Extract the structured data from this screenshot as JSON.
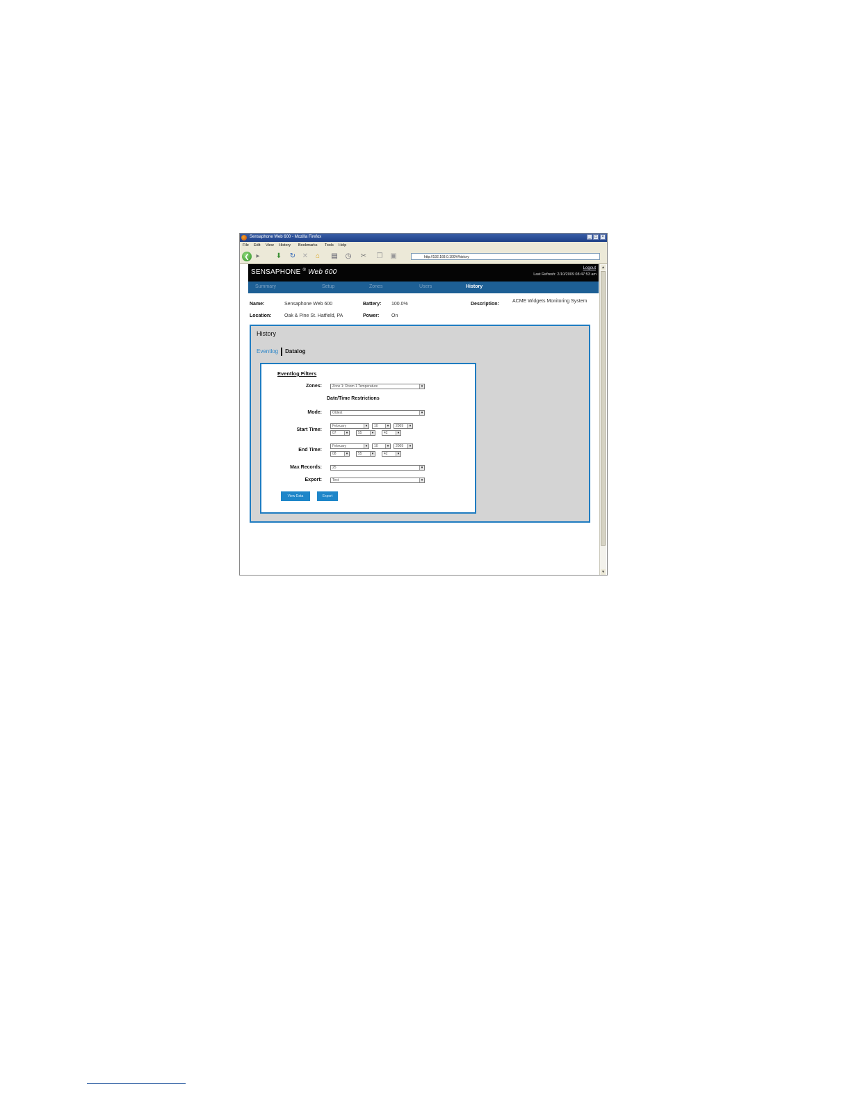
{
  "window": {
    "title": "Sensaphone Web 600 - Mozilla Firefox",
    "controls": [
      "_",
      "□",
      "×"
    ],
    "menu": [
      "File",
      "Edit",
      "View",
      "History",
      "Bookmarks",
      "Tools",
      "Help"
    ],
    "url": "http://192.168.0.100/#/history"
  },
  "header": {
    "brand": "SENSAPHONE",
    "registered": "®",
    "model": "Web 600",
    "logout": "Logout",
    "last_refresh": "Last Refresh: 2/10/2009 08:47:53 am"
  },
  "tabs": [
    "Summary",
    "Setup",
    "Zones",
    "Users",
    "History"
  ],
  "active_tab": "History",
  "device_info": {
    "name_label": "Name:",
    "name": "Sensaphone Web 600",
    "location_label": "Location:",
    "location": "Oak & Pine St. Hatfield, PA",
    "battery_label": "Battery:",
    "battery": "100.0%",
    "power_label": "Power:",
    "power": "On",
    "description_label": "Description:",
    "description": "ACME Widgets Monitoring System"
  },
  "history": {
    "title": "History",
    "subnav": [
      "Eventlog",
      "Datalog"
    ],
    "active_subnav": "Eventlog",
    "filters": {
      "heading": "Eventlog Filters",
      "zones_label": "Zones:",
      "zones_value": "Zone 1: Room 1 Temperature",
      "restrictions_heading": "Date/Time Restrictions",
      "mode_label": "Mode:",
      "mode_value": "Oldest",
      "start_label": "Start Time:",
      "start": {
        "month": "February",
        "day": "10",
        "year": "2009",
        "hour": "07",
        "minute": "55",
        "second": "42"
      },
      "end_label": "End Time:",
      "end": {
        "month": "February",
        "day": "10",
        "year": "2009",
        "hour": "08",
        "minute": "55",
        "second": "42"
      },
      "max_records_label": "Max Records:",
      "max_records_value": "25",
      "export_label": "Export:",
      "export_value": "Text",
      "view_button": "View Data",
      "export_button": "Export"
    }
  },
  "colors": {
    "nav_blue": "#1d5f95",
    "frame_blue": "#1f7cc1",
    "panel_gray": "#d4d4d4",
    "banner_black": "#050505"
  }
}
